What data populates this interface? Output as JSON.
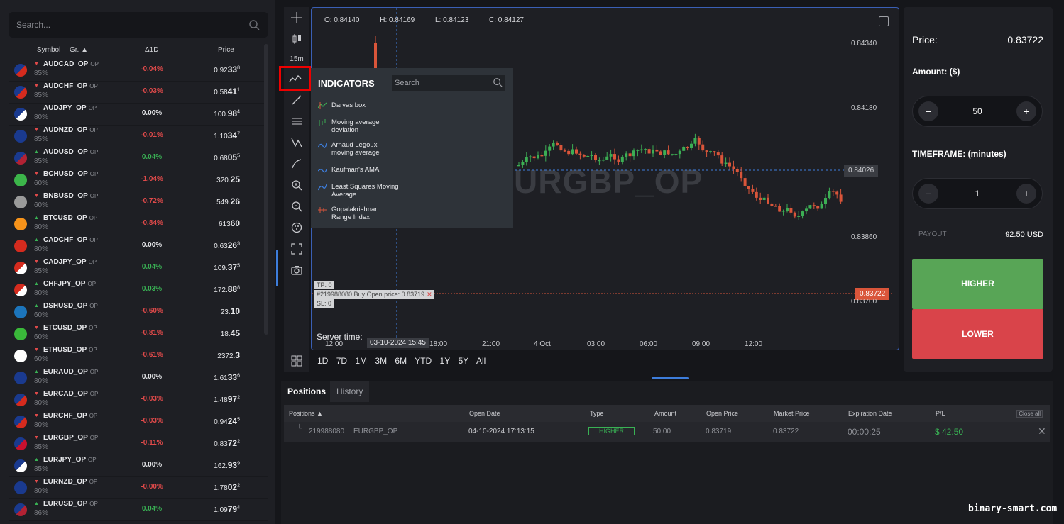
{
  "search": {
    "placeholder": "Search..."
  },
  "table_headers": {
    "symbol": "Symbol",
    "group": "Gr.",
    "change": "Δ1D",
    "price": "Price"
  },
  "assets": [
    {
      "symbol": "AUDCAD_OP",
      "tag": "OP",
      "payout": "85%",
      "dir": "down",
      "change": "-0.04%",
      "price_main": "0.92",
      "price_big": "33",
      "price_sup": "8",
      "flag_a": "#1a3a8f",
      "flag_b": "#d52b1e"
    },
    {
      "symbol": "AUDCHF_OP",
      "tag": "OP",
      "payout": "85%",
      "dir": "down",
      "change": "-0.03%",
      "price_main": "0.58",
      "price_big": "41",
      "price_sup": "1",
      "flag_a": "#1a3a8f",
      "flag_b": "#d52b1e"
    },
    {
      "symbol": "AUDJPY_OP",
      "tag": "OP",
      "payout": "80%",
      "dir": "none",
      "change": "0.00%",
      "price_main": "100.",
      "price_big": "98",
      "price_sup": "4",
      "flag_a": "#1a3a8f",
      "flag_b": "#ffffff"
    },
    {
      "symbol": "AUDNZD_OP",
      "tag": "OP",
      "payout": "85%",
      "dir": "down",
      "change": "-0.01%",
      "price_main": "1.10",
      "price_big": "34",
      "price_sup": "7",
      "flag_a": "#1a3a8f",
      "flag_b": "#1a3a8f"
    },
    {
      "symbol": "AUDUSD_OP",
      "tag": "OP",
      "payout": "85%",
      "dir": "up",
      "change": "0.04%",
      "price_main": "0.68",
      "price_big": "05",
      "price_sup": "5",
      "flag_a": "#1a3a8f",
      "flag_b": "#b22234"
    },
    {
      "symbol": "BCHUSD_OP",
      "tag": "OP",
      "payout": "60%",
      "dir": "down",
      "change": "-1.04%",
      "price_main": "320.",
      "price_big": "25",
      "price_sup": "",
      "flag_a": "#3cb54a",
      "flag_b": "#3cb54a"
    },
    {
      "symbol": "BNBUSD_OP",
      "tag": "OP",
      "payout": "60%",
      "dir": "down",
      "change": "-0.72%",
      "price_main": "549.",
      "price_big": "26",
      "price_sup": "",
      "flag_a": "#9a9a9a",
      "flag_b": "#9a9a9a"
    },
    {
      "symbol": "BTCUSD_OP",
      "tag": "OP",
      "payout": "80%",
      "dir": "up",
      "change": "-0.84%",
      "price_main": "613",
      "price_big": "60",
      "price_sup": "",
      "flag_a": "#f7931a",
      "flag_b": "#f7931a"
    },
    {
      "symbol": "CADCHF_OP",
      "tag": "OP",
      "payout": "80%",
      "dir": "up",
      "change": "0.00%",
      "price_main": "0.63",
      "price_big": "26",
      "price_sup": "3",
      "flag_a": "#d52b1e",
      "flag_b": "#d52b1e"
    },
    {
      "symbol": "CADJPY_OP",
      "tag": "OP",
      "payout": "85%",
      "dir": "down",
      "change": "0.04%",
      "price_main": "109.",
      "price_big": "37",
      "price_sup": "5",
      "flag_a": "#d52b1e",
      "flag_b": "#ffffff"
    },
    {
      "symbol": "CHFJPY_OP",
      "tag": "OP",
      "payout": "80%",
      "dir": "up",
      "change": "0.03%",
      "price_main": "172.",
      "price_big": "88",
      "price_sup": "8",
      "flag_a": "#d52b1e",
      "flag_b": "#ffffff"
    },
    {
      "symbol": "DSHUSD_OP",
      "tag": "OP",
      "payout": "60%",
      "dir": "up",
      "change": "-0.60%",
      "price_main": "23.",
      "price_big": "10",
      "price_sup": "",
      "flag_a": "#1c75bc",
      "flag_b": "#1c75bc"
    },
    {
      "symbol": "ETCUSD_OP",
      "tag": "OP",
      "payout": "60%",
      "dir": "down",
      "change": "-0.81%",
      "price_main": "18.",
      "price_big": "45",
      "price_sup": "",
      "flag_a": "#3ab83a",
      "flag_b": "#3ab83a"
    },
    {
      "symbol": "ETHUSD_OP",
      "tag": "OP",
      "payout": "60%",
      "dir": "down",
      "change": "-0.61%",
      "price_main": "2372.",
      "price_big": "3",
      "price_sup": "",
      "flag_a": "#ffffff",
      "flag_b": "#ffffff"
    },
    {
      "symbol": "EURAUD_OP",
      "tag": "OP",
      "payout": "80%",
      "dir": "up",
      "change": "0.00%",
      "price_main": "1.61",
      "price_big": "33",
      "price_sup": "6",
      "flag_a": "#1a3a8f",
      "flag_b": "#1a3a8f"
    },
    {
      "symbol": "EURCAD_OP",
      "tag": "OP",
      "payout": "80%",
      "dir": "down",
      "change": "-0.03%",
      "price_main": "1.48",
      "price_big": "97",
      "price_sup": "2",
      "flag_a": "#1a3a8f",
      "flag_b": "#d52b1e"
    },
    {
      "symbol": "EURCHF_OP",
      "tag": "OP",
      "payout": "80%",
      "dir": "down",
      "change": "-0.03%",
      "price_main": "0.94",
      "price_big": "24",
      "price_sup": "5",
      "flag_a": "#1a3a8f",
      "flag_b": "#d52b1e"
    },
    {
      "symbol": "EURGBP_OP",
      "tag": "OP",
      "payout": "85%",
      "dir": "down",
      "change": "-0.11%",
      "price_main": "0.83",
      "price_big": "72",
      "price_sup": "2",
      "flag_a": "#1a3a8f",
      "flag_b": "#c8102e"
    },
    {
      "symbol": "EURJPY_OP",
      "tag": "OP",
      "payout": "85%",
      "dir": "up",
      "change": "0.00%",
      "price_main": "162.",
      "price_big": "93",
      "price_sup": "9",
      "flag_a": "#1a3a8f",
      "flag_b": "#ffffff"
    },
    {
      "symbol": "EURNZD_OP",
      "tag": "OP",
      "payout": "80%",
      "dir": "down",
      "change": "-0.00%",
      "price_main": "1.78",
      "price_big": "02",
      "price_sup": "2",
      "flag_a": "#1a3a8f",
      "flag_b": "#1a3a8f"
    },
    {
      "symbol": "EURUSD_OP",
      "tag": "OP",
      "payout": "86%",
      "dir": "up",
      "change": "0.04%",
      "price_main": "1.09",
      "price_big": "79",
      "price_sup": "4",
      "flag_a": "#1a3a8f",
      "flag_b": "#b22234"
    }
  ],
  "toolbar": {
    "timeframe": "15m"
  },
  "chart": {
    "ohlc": {
      "o": "O: 0.84140",
      "h": "H: 0.84169",
      "l": "L: 0.84123",
      "c": "C: 0.84127"
    },
    "watermark": "URGBP_OP",
    "y_labels": [
      "0.84340",
      "0.84180",
      "0.84026",
      "0.83860",
      "0.83700"
    ],
    "current_price": "0.83722",
    "x_labels": [
      "12:00",
      "18:00",
      "21:00",
      "4 Oct",
      "03:00",
      "06:00",
      "09:00",
      "12:00"
    ],
    "server_time_label": "Server time:",
    "server_time": "03-10-2024 15:45",
    "tp": "TP: 0",
    "trade": "#219988080  Buy  Open price: 0.83719",
    "sl": "SL: 0",
    "colors": {
      "up": "#3cae54",
      "down": "#d9553a"
    }
  },
  "indicators": {
    "title": "INDICATORS",
    "search_placeholder": "Search",
    "items": [
      {
        "l1": "Darvas box",
        "l2": ""
      },
      {
        "l1": "Moving average",
        "l2": "deviation"
      },
      {
        "l1": "Arnaud Legoux",
        "l2": "moving average"
      },
      {
        "l1": "Kaufman's AMA",
        "l2": ""
      },
      {
        "l1": "Least Squares Moving",
        "l2": "Average"
      },
      {
        "l1": "Gopalakrishnan",
        "l2": "Range Index"
      }
    ]
  },
  "periods": [
    "1D",
    "7D",
    "1M",
    "3M",
    "6M",
    "YTD",
    "1Y",
    "5Y",
    "All"
  ],
  "trade_panel": {
    "price_label": "Price:",
    "price": "0.83722",
    "amount_label": "Amount: ($)",
    "amount": "50",
    "timeframe_label": "TIMEFRAME: (minutes)",
    "timeframe": "1",
    "payout_label": "PAYOUT",
    "payout": "92.50 USD",
    "higher": "HIGHER",
    "lower": "LOWER"
  },
  "positions": {
    "tabs": [
      "Positions",
      "History"
    ],
    "headers": [
      "Positions ▲",
      "Open Date",
      "Type",
      "Amount",
      "Open Price",
      "Market Price",
      "Expiration Date",
      "P/L"
    ],
    "close_all": "Close all",
    "row": {
      "id": "219988080",
      "symbol": "EURGBP_OP",
      "open_date": "04-10-2024 17:13:15",
      "type": "HIGHER",
      "amount": "50.00",
      "open_price": "0.83719",
      "market_price": "0.83722",
      "expiration": "00:00:25",
      "pl": "$ 42.50"
    }
  },
  "brand": "binary-smart.com"
}
